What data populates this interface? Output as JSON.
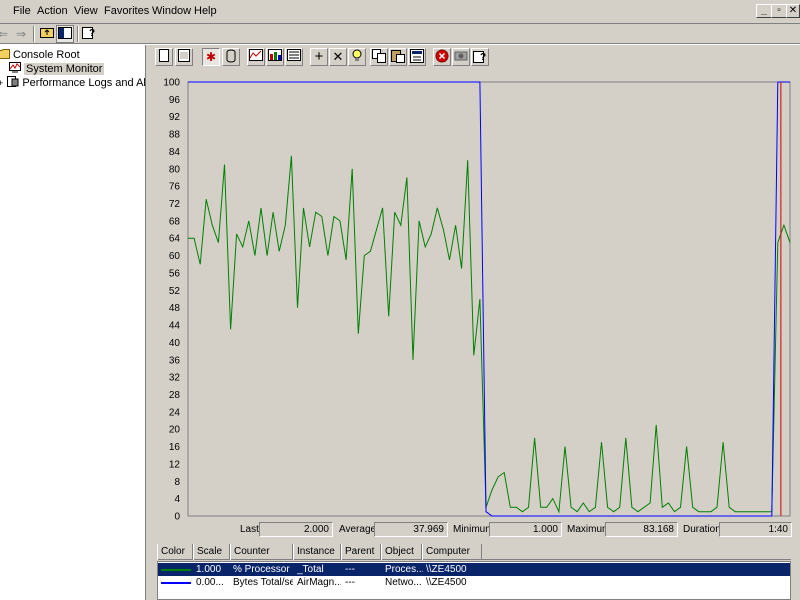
{
  "menubar": {
    "items": [
      {
        "label": "File"
      },
      {
        "label": "Action"
      },
      {
        "label": "View"
      },
      {
        "label": "Favorites"
      },
      {
        "label": "Window"
      },
      {
        "label": "Help"
      }
    ]
  },
  "window_controls": {
    "minimize": "_",
    "restore": "▫",
    "close": "✕"
  },
  "tree": {
    "items": [
      {
        "label": "Console Root",
        "icon": "folder-icon"
      },
      {
        "label": "System Monitor",
        "icon": "system-monitor-icon",
        "selected": true
      },
      {
        "label": "Performance Logs and Alerts",
        "icon": "performance-logs-icon"
      }
    ]
  },
  "graph_toolbar": {
    "buttons": [
      "new-counter-set-icon",
      "clear-display-icon",
      "view-current-activity-icon",
      "view-log-data-icon",
      "view-graph-icon",
      "view-histogram-icon",
      "view-report-icon",
      "add-counter-icon",
      "delete-counter-icon",
      "highlight-icon",
      "copy-properties-icon",
      "paste-counter-list-icon",
      "properties-icon",
      "freeze-display-icon",
      "update-data-icon",
      "help-icon"
    ]
  },
  "stats": {
    "last_label": "Last",
    "last_value": "2.000",
    "average_label": "Average",
    "average_value": "37.969",
    "minimum_label": "Minimum",
    "minimum_value": "1.000",
    "maximum_label": "Maximum",
    "maximum_value": "83.168",
    "duration_label": "Duration",
    "duration_value": "1:40"
  },
  "legend": {
    "headers": [
      "Color",
      "Scale",
      "Counter",
      "Instance",
      "Parent",
      "Object",
      "Computer"
    ],
    "rows": [
      {
        "color": "#008000",
        "scale": "1.000",
        "counter": "% Processor ...",
        "instance": "_Total",
        "parent": "---",
        "object": "Proces...",
        "computer": "\\\\ZE4500",
        "selected": true
      },
      {
        "color": "#0000ff",
        "scale": "0.00...",
        "counter": "Bytes Total/sec",
        "instance": "AirMagn...",
        "parent": "---",
        "object": "Netwo...",
        "computer": "\\\\ZE4500",
        "selected": false
      }
    ]
  },
  "chart_data": {
    "type": "line",
    "ylim": [
      0,
      100
    ],
    "y_ticks": [
      "100",
      "96",
      "92",
      "88",
      "84",
      "80",
      "76",
      "72",
      "68",
      "64",
      "60",
      "56",
      "52",
      "48",
      "44",
      "40",
      "36",
      "32",
      "28",
      "24",
      "20",
      "16",
      "12",
      "8",
      "4",
      "0"
    ],
    "current_position": 97.5,
    "series": [
      {
        "color": "#008000",
        "x": [
          0,
          1,
          2,
          3,
          4,
          5,
          6,
          7,
          8,
          9,
          10,
          11,
          12,
          13,
          14,
          15,
          16,
          17,
          18,
          19,
          20,
          21,
          22,
          23,
          24,
          25,
          26,
          27,
          28,
          29,
          30,
          31,
          32,
          33,
          34,
          35,
          36,
          37,
          38,
          39,
          40,
          41,
          42,
          43,
          44,
          45,
          46,
          47,
          48,
          49,
          50,
          51,
          52,
          53,
          54,
          55,
          56,
          57,
          58,
          59,
          60,
          61,
          62,
          63,
          64,
          65,
          66,
          67,
          68,
          69,
          70,
          71,
          72,
          73,
          74,
          75,
          76,
          77,
          78,
          79,
          80,
          81,
          82,
          83,
          84,
          85,
          86,
          87,
          88,
          89,
          90,
          91,
          92,
          93,
          94,
          95,
          96,
          97,
          98,
          99
        ],
        "values": [
          64,
          64,
          58,
          73,
          67,
          63,
          81,
          43,
          65,
          62,
          68,
          60,
          71,
          60,
          70,
          61,
          67,
          83,
          48,
          71,
          62,
          70,
          69,
          60,
          69,
          68,
          59,
          80,
          42,
          60,
          61,
          66,
          71,
          46,
          70,
          67,
          78,
          36,
          68,
          62,
          65,
          71,
          66,
          59,
          67,
          57,
          82,
          37,
          50,
          2,
          6,
          9,
          10,
          2,
          2,
          1,
          2,
          18,
          2,
          2,
          4,
          1,
          16,
          2,
          1,
          3,
          1,
          2,
          17,
          2,
          1,
          2,
          18,
          2,
          1,
          2,
          3,
          21,
          2,
          3,
          1,
          2,
          16,
          2,
          1,
          1,
          1,
          2,
          17,
          2,
          1,
          1,
          1,
          1,
          1,
          1,
          1,
          63,
          67,
          63
        ]
      },
      {
        "color": "#0000ff",
        "x": [
          0,
          1,
          2,
          3,
          4,
          5,
          6,
          7,
          8,
          9,
          10,
          11,
          12,
          13,
          14,
          15,
          16,
          17,
          18,
          19,
          20,
          21,
          22,
          23,
          24,
          25,
          26,
          27,
          28,
          29,
          30,
          31,
          32,
          33,
          34,
          35,
          36,
          37,
          38,
          39,
          40,
          41,
          42,
          43,
          44,
          45,
          46,
          47,
          48,
          49,
          50,
          51,
          52,
          53,
          54,
          55,
          56,
          57,
          58,
          59,
          60,
          61,
          62,
          63,
          64,
          65,
          66,
          67,
          68,
          69,
          70,
          71,
          72,
          73,
          74,
          75,
          76,
          77,
          78,
          79,
          80,
          81,
          82,
          83,
          84,
          85,
          86,
          87,
          88,
          89,
          90,
          91,
          92,
          93,
          94,
          95,
          96,
          97,
          98,
          99
        ],
        "values": [
          100,
          100,
          100,
          100,
          100,
          100,
          100,
          100,
          100,
          100,
          100,
          100,
          100,
          100,
          100,
          100,
          100,
          100,
          100,
          100,
          100,
          100,
          100,
          100,
          100,
          100,
          100,
          100,
          100,
          100,
          100,
          100,
          100,
          100,
          100,
          100,
          100,
          100,
          100,
          100,
          100,
          100,
          100,
          100,
          100,
          100,
          100,
          100,
          100,
          1,
          0,
          0,
          0,
          0,
          0,
          0,
          0,
          0,
          0,
          0,
          0,
          0,
          0,
          0,
          0,
          0,
          0,
          0,
          0,
          0,
          0,
          0,
          0,
          0,
          0,
          0,
          0,
          0,
          0,
          0,
          0,
          0,
          0,
          0,
          0,
          0,
          0,
          0,
          0,
          0,
          0,
          0,
          0,
          0,
          0,
          0,
          0,
          100,
          100,
          100
        ]
      }
    ]
  }
}
